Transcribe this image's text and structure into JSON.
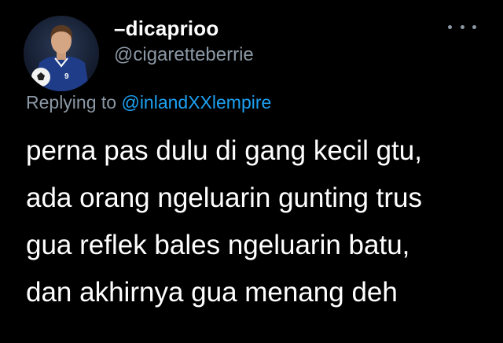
{
  "user": {
    "display_name": "–dicaprioo",
    "handle": "@cigaretteberrie"
  },
  "reply": {
    "prefix": "Replying to",
    "mention": "@inlandXXlempire"
  },
  "tweet": {
    "lines": [
      "perna pas dulu di gang kecil gtu,",
      "ada orang ngeluarin gunting trus",
      "gua reflek bales ngeluarin batu,",
      "dan akhirnya gua menang deh"
    ]
  },
  "colors": {
    "background": "#000000",
    "text_primary": "#ffffff",
    "text_secondary": "#8b98a5",
    "link": "#1da1f2"
  },
  "icons": {
    "more": "more-horizontal-icon"
  }
}
